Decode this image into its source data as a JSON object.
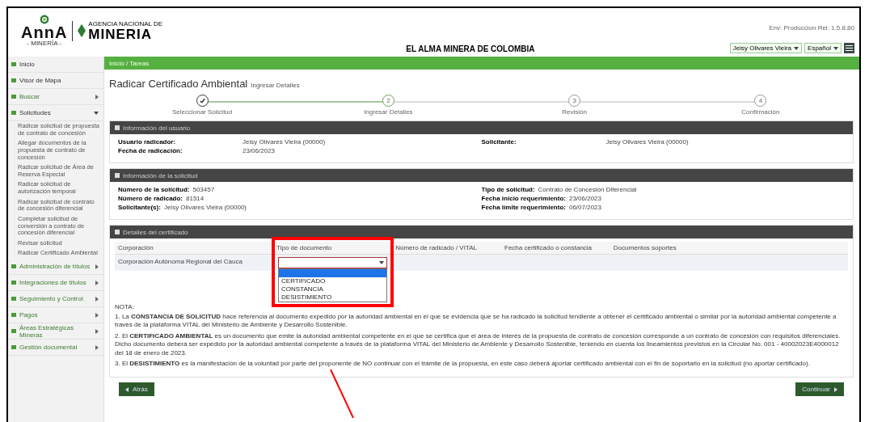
{
  "header": {
    "env": "Env: Produccion Rel: 1.5.8.80",
    "logo_brand": "AnnA",
    "logo_sub": "- MINERÍA -",
    "agency_small": "AGENCIA NACIONAL DE",
    "agency": "MINERIA",
    "tagline": "EL ALMA MINERA DE COLOMBIA",
    "user_button": "Jeisy Olivares Vieira",
    "language_button": "Español"
  },
  "sidebar": [
    {
      "kind": "link",
      "label": "Inicio"
    },
    {
      "kind": "link",
      "label": "Visor de Mapa"
    },
    {
      "kind": "menu",
      "label": "Buscar",
      "expanded": false
    },
    {
      "kind": "menu",
      "label": "Solicitudes",
      "expanded": true,
      "children": [
        {
          "label": "Radicar solicitud de propuesta de contrato de concesión"
        },
        {
          "label": "Allegar documentos de la propuesta de contrato de concesión"
        },
        {
          "label": "Radicar solicitud de Área de Reserva Especial"
        },
        {
          "label": "Radicar solicitud de autorización temporal"
        },
        {
          "label": "Radicar solicitud de contrato de concesión diferencial"
        },
        {
          "label": "Completar solicitud de conversión a contrato de concesión diferencial"
        },
        {
          "label": "Revisar solicitud"
        },
        {
          "label": "Radicar Certificado Ambiental"
        }
      ]
    },
    {
      "kind": "menu",
      "label": "Administración de títulos",
      "expanded": false
    },
    {
      "kind": "menu",
      "label": "Integraciones de títulos",
      "expanded": false
    },
    {
      "kind": "menu",
      "label": "Seguimiento y Control",
      "expanded": false
    },
    {
      "kind": "menu",
      "label": "Pagos",
      "expanded": false
    },
    {
      "kind": "menu",
      "label": "Áreas Estratégicas Mineras",
      "expanded": false
    },
    {
      "kind": "menu",
      "label": "Gestión documental",
      "expanded": false
    }
  ],
  "breadcrumb": "Inicio / Tareas",
  "page_title": "Radicar Certificado Ambiental",
  "page_subtitle": "Ingresar Detalles",
  "steps": [
    {
      "label": "Seleccionar Solicitud",
      "completed": true,
      "selected": false
    },
    {
      "number": "2",
      "label": "Ingresar Detalles",
      "completed": false,
      "selected": true
    },
    {
      "number": "3",
      "label": "Revisión",
      "completed": false,
      "selected": false
    },
    {
      "number": "4",
      "label": "Confirmación",
      "completed": false,
      "selected": false
    }
  ],
  "user_panel": {
    "title": "Información del usuario",
    "left": [
      {
        "label": "Usuario radicador:",
        "value": "Jeisy Olivares Vieira (00000)"
      },
      {
        "label": "Fecha de radicación:",
        "value": "23/06/2023"
      }
    ],
    "right": [
      {
        "label": "Solicitante:",
        "value": "Jeisy Olivares Vieira (00000)"
      }
    ]
  },
  "request_panel": {
    "title": "Información de la solicitud",
    "left": [
      {
        "label": "Número de la solicitud:",
        "value": "503457"
      },
      {
        "label": "Número de radicado:",
        "value": "81514"
      },
      {
        "label": "Solicitante(s):",
        "value": "Jeisy Olivares Vieira (00000)"
      }
    ],
    "right": [
      {
        "label": "Tipo de solicitud:",
        "value": "Contrato de Concesión Diferencial"
      },
      {
        "label": "Fecha inicio requerimiento:",
        "value": "23/06/2023"
      },
      {
        "label": "Fecha límite requerimiento:",
        "value": "06/07/2023"
      }
    ]
  },
  "certificate_panel": {
    "title": "Detalles del certificado",
    "columns": [
      "Corporación",
      "Tipo de documento",
      "Número de radicado / VITAL",
      "Fecha certificado o constancia",
      "Documentos soportes"
    ],
    "rows": [
      {
        "corporation": "Corporación Autónoma Regional del Cauca",
        "document_type": {
          "open": true,
          "blank_highlighted": true,
          "options": [
            {
              "label": "CERTIFICADO",
              "selected": false
            },
            {
              "label": "CONSTANCIA",
              "selected": false
            },
            {
              "label": "DESISTIMIENTO",
              "selected": false
            }
          ]
        }
      }
    ],
    "notes_title": "NOTA:",
    "notes": [
      "1. La **CONSTANCIA DE SOLICITUD** hace referencia al documento expedido por la autoridad ambiental en el que se evidencia que se ha radicado la solicitud tendiente a obtener el certificado ambiental o similar por la autoridad ambiental competente a través de la plataforma VITAL del Ministerio de Ambiente y Desarrollo Sostenible.",
      "2. El **CERTIFICADO AMBIENTAL** es un documento que emite la autoridad ambiental competente en el que se certifica que el área de interés de la propuesta de contrato de concesión corresponde a un contrato de concesión con requisitos diferenciales. Dicho documento deberá ser expedido por la autoridad ambiental competente a través de la plataforma VITAL del Ministerio de Ambiente y Desarrollo Sostenible, teniendo en cuenta los lineamientos previstos en la Circular No. 001 - 40002023E4000012 del 18 de enero de 2023.",
      "3. El **DESISTIMIENTO** es la manifestación de la voluntad por parte del proponente de NO continuar con el trámite de la propuesta, en este caso deberá aportar certificado ambiental con el fin de soportarlo en la solicitud (no aportar certificado)."
    ]
  },
  "buttons": {
    "back": "Atrás",
    "next": "Continuar"
  },
  "annotation": {
    "visible": true
  }
}
